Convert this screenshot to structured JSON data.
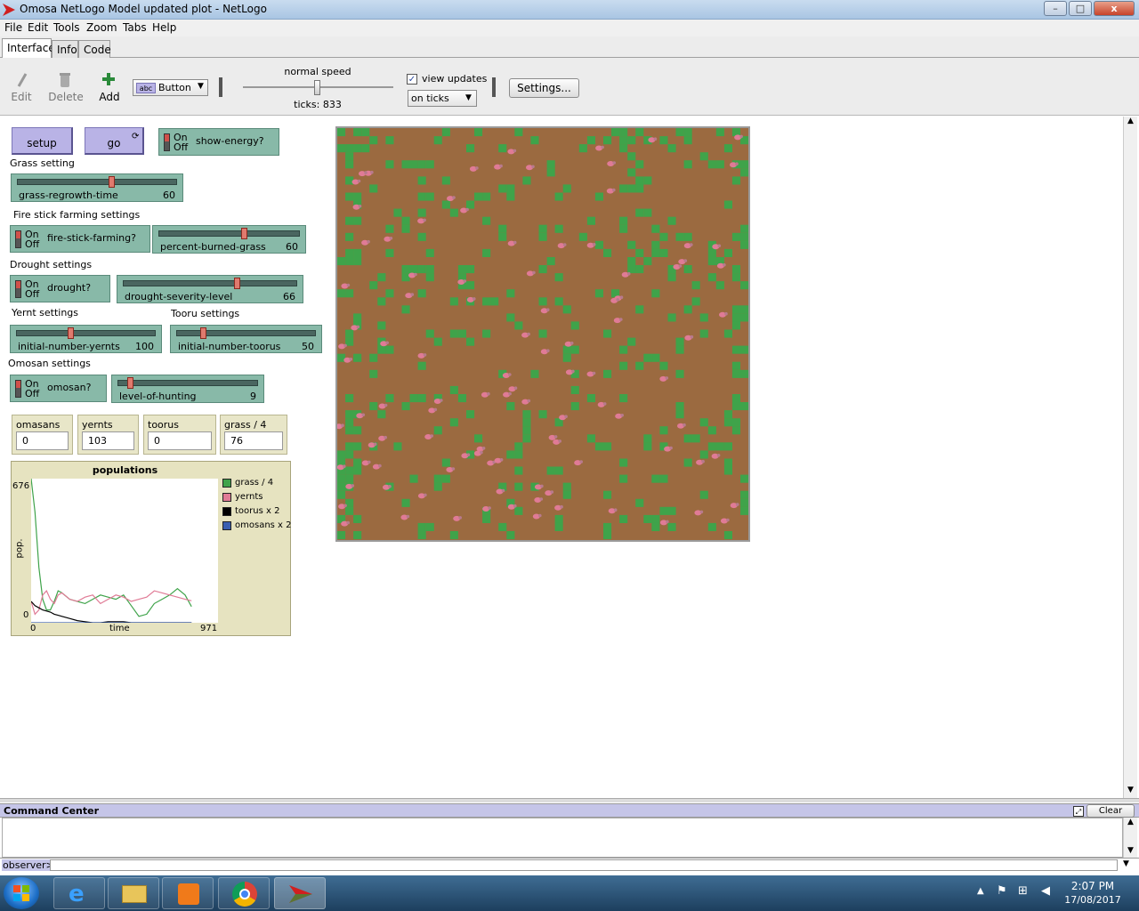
{
  "window": {
    "title": "Omosa NetLogo Model updated plot - NetLogo",
    "min": "–",
    "max": "□",
    "close": "x"
  },
  "menu": [
    "File",
    "Edit",
    "Tools",
    "Zoom",
    "Tabs",
    "Help"
  ],
  "tabs": [
    "Interface",
    "Info",
    "Code"
  ],
  "toolbar": {
    "edit": "Edit",
    "delete": "Delete",
    "add": "Add",
    "widget_type": "Button",
    "speed_label": "normal speed",
    "ticks_label": "ticks: 833",
    "view_updates_label": "view updates",
    "view_updates_checked": true,
    "update_mode": "on ticks",
    "settings": "Settings..."
  },
  "widgets": {
    "setup": "setup",
    "go": "go",
    "show_energy": {
      "on": "On",
      "off": "Off",
      "label": "show-energy?"
    },
    "grass_setting_label": "Grass setting",
    "grass_regrowth": {
      "label": "grass-regrowth-time",
      "value": "60",
      "fraction": 0.6
    },
    "fire_label": "Fire stick farming settings",
    "fire_switch": {
      "on": "On",
      "off": "Off",
      "label": "fire-stick-farming?"
    },
    "percent_burned": {
      "label": "percent-burned-grass",
      "value": "60",
      "fraction": 0.6
    },
    "drought_label": "Drought settings",
    "drought_switch": {
      "on": "On",
      "off": "Off",
      "label": "drought?"
    },
    "drought_severity": {
      "label": "drought-severity-level",
      "value": "66",
      "fraction": 0.66
    },
    "yernt_label": "Yernt settings",
    "tooru_label": "Tooru settings",
    "init_yernts": {
      "label": "initial-number-yernts",
      "value": "100",
      "fraction": 0.33
    },
    "init_toorus": {
      "label": "initial-number-toorus",
      "value": "50",
      "fraction": 0.17
    },
    "omosan_label": "Omosan settings",
    "omosan_switch": {
      "on": "On",
      "off": "Off",
      "label": "omosan?"
    },
    "level_hunting": {
      "label": "level-of-hunting",
      "value": "9",
      "fraction": 0.09
    },
    "monitors": [
      {
        "label": "omasans",
        "value": "0"
      },
      {
        "label": "yernts",
        "value": "103"
      },
      {
        "label": "toorus",
        "value": "0"
      },
      {
        "label": "grass / 4",
        "value": "76"
      }
    ]
  },
  "chart_data": {
    "type": "line",
    "title": "populations",
    "xlabel": "time",
    "ylabel": "pop.",
    "xlim": [
      0,
      971
    ],
    "ylim": [
      0,
      676
    ],
    "x_ticks": [
      "0",
      "971"
    ],
    "y_ticks": [
      "676",
      "0"
    ],
    "legend_position": "right",
    "series": [
      {
        "name": "grass / 4",
        "color": "#3fa34a",
        "x": [
          0,
          20,
          40,
          60,
          80,
          100,
          120,
          140,
          160,
          200,
          240,
          280,
          320,
          360,
          400,
          440,
          480,
          520,
          560,
          600,
          640,
          680,
          720,
          760,
          800,
          833
        ],
        "y": [
          676,
          520,
          260,
          110,
          60,
          60,
          100,
          150,
          140,
          110,
          100,
          90,
          110,
          130,
          120,
          110,
          130,
          80,
          30,
          40,
          90,
          110,
          130,
          160,
          130,
          76
        ]
      },
      {
        "name": "yernts",
        "color": "#e07b96",
        "x": [
          0,
          20,
          40,
          60,
          80,
          100,
          120,
          140,
          160,
          200,
          240,
          280,
          320,
          360,
          400,
          440,
          480,
          520,
          560,
          600,
          640,
          680,
          720,
          760,
          800,
          833
        ],
        "y": [
          100,
          40,
          60,
          130,
          150,
          110,
          90,
          130,
          140,
          110,
          100,
          120,
          130,
          90,
          110,
          130,
          120,
          100,
          110,
          120,
          150,
          140,
          130,
          120,
          110,
          103
        ]
      },
      {
        "name": "toorus x 2",
        "color": "#000000",
        "x": [
          0,
          20,
          40,
          60,
          80,
          100,
          120,
          140,
          160,
          200,
          240,
          280,
          320,
          360,
          400,
          440,
          480,
          520,
          560,
          600,
          640,
          680,
          720,
          760,
          800,
          833
        ],
        "y": [
          100,
          80,
          70,
          60,
          55,
          50,
          40,
          35,
          30,
          20,
          10,
          5,
          0,
          0,
          5,
          5,
          5,
          0,
          0,
          0,
          0,
          0,
          0,
          0,
          0,
          0
        ]
      },
      {
        "name": "omosans x 2",
        "color": "#3a5fb0",
        "x": [
          0,
          833
        ],
        "y": [
          0,
          0
        ]
      }
    ]
  },
  "command_center": {
    "title": "Command Center",
    "clear": "Clear",
    "prompt": "observer>"
  },
  "tray": {
    "time": "2:07 PM",
    "date": "17/08/2017"
  },
  "colors": {
    "grass": "#3fa34a",
    "dirt": "#9b6a40",
    "sheep": "#e07b96"
  }
}
